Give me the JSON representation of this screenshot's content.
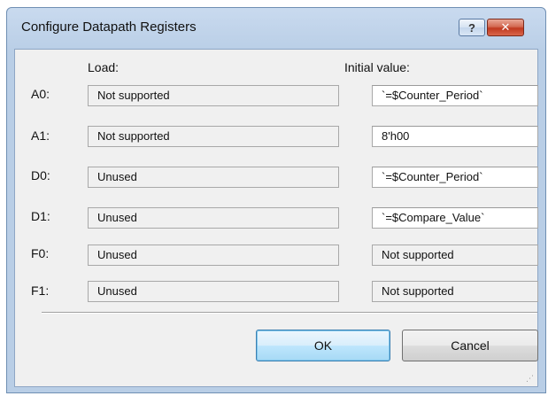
{
  "dialog": {
    "title": "Configure Datapath Registers",
    "help_label": "?",
    "close_label": "✕"
  },
  "columns": {
    "load": "Load:",
    "initial": "Initial value:"
  },
  "rows": [
    {
      "label": "A0:",
      "load": "Not supported",
      "initial": "`=$Counter_Period`"
    },
    {
      "label": "A1:",
      "load": "Not supported",
      "initial": "8'h00"
    },
    {
      "label": "D0:",
      "load": "Unused",
      "initial": "`=$Counter_Period`"
    },
    {
      "label": "D1:",
      "load": "Unused",
      "initial": "`=$Compare_Value`"
    },
    {
      "label": "F0:",
      "load": "Unused",
      "initial": "Not supported"
    },
    {
      "label": "F1:",
      "load": "Unused",
      "initial": "Not supported"
    }
  ],
  "buttons": {
    "ok": "OK",
    "cancel": "Cancel"
  },
  "icons": {
    "help": "help-icon",
    "close": "close-icon",
    "resize": "resize-grip-icon"
  }
}
